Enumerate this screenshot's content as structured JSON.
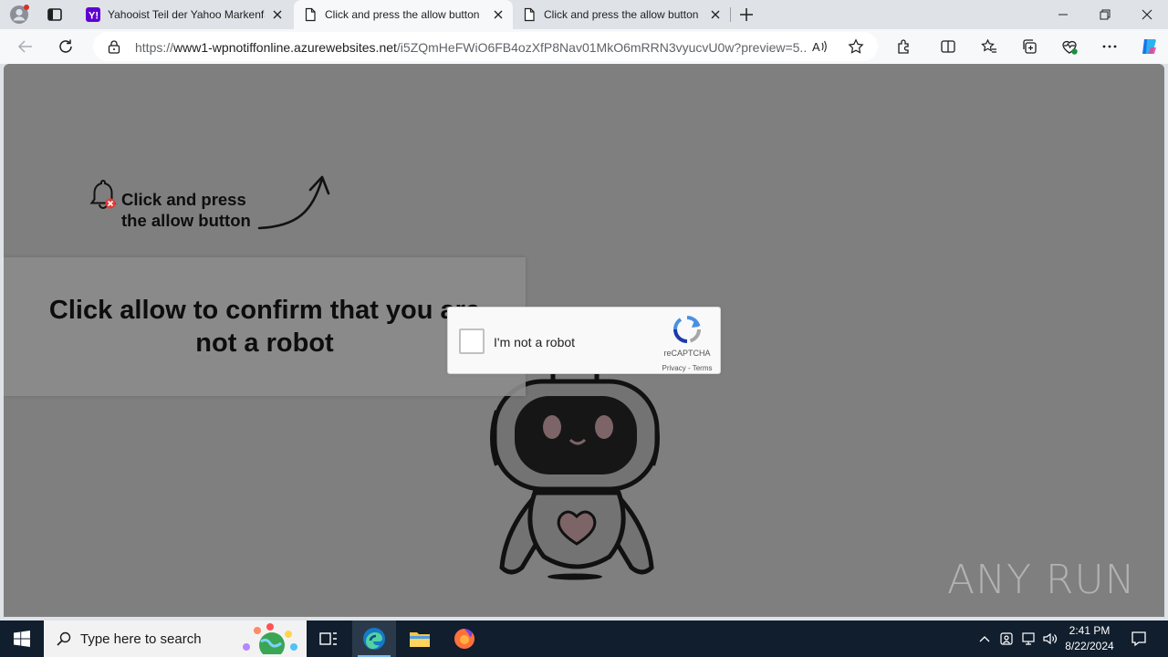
{
  "browser": {
    "tabs": [
      {
        "title": "Yahooist Teil der Yahoo Markenfamilie"
      },
      {
        "title": "Click and press the allow button"
      },
      {
        "title": "Click and press the allow button"
      }
    ],
    "url_prefix": "https://",
    "url_host": "www1-wpnotiffonline.azurewebsites.net",
    "url_path": "/i5ZQmHeFWiO6FB4ozXfP8Nav01MkO6mRRN3vyucvU0w?preview=5..."
  },
  "page": {
    "hint_line1": "Click and press",
    "hint_line2": "the allow button",
    "confirm_line1": "Click allow to confirm that you are",
    "confirm_line2": "not a robot",
    "captcha": {
      "label": "I'm not a robot",
      "brand": "reCAPTCHA",
      "links": "Privacy - Terms",
      "checked": false
    },
    "watermark": "ANY RUN"
  },
  "taskbar": {
    "search_placeholder": "Type here to search",
    "time": "2:41 PM",
    "date": "8/22/2024"
  },
  "colors": {
    "page_overlay": "#7f7f7f",
    "taskbar": "#101e2d",
    "yahoo_purple": "#6001d2",
    "recaptcha_blue": "#4a90e2"
  }
}
